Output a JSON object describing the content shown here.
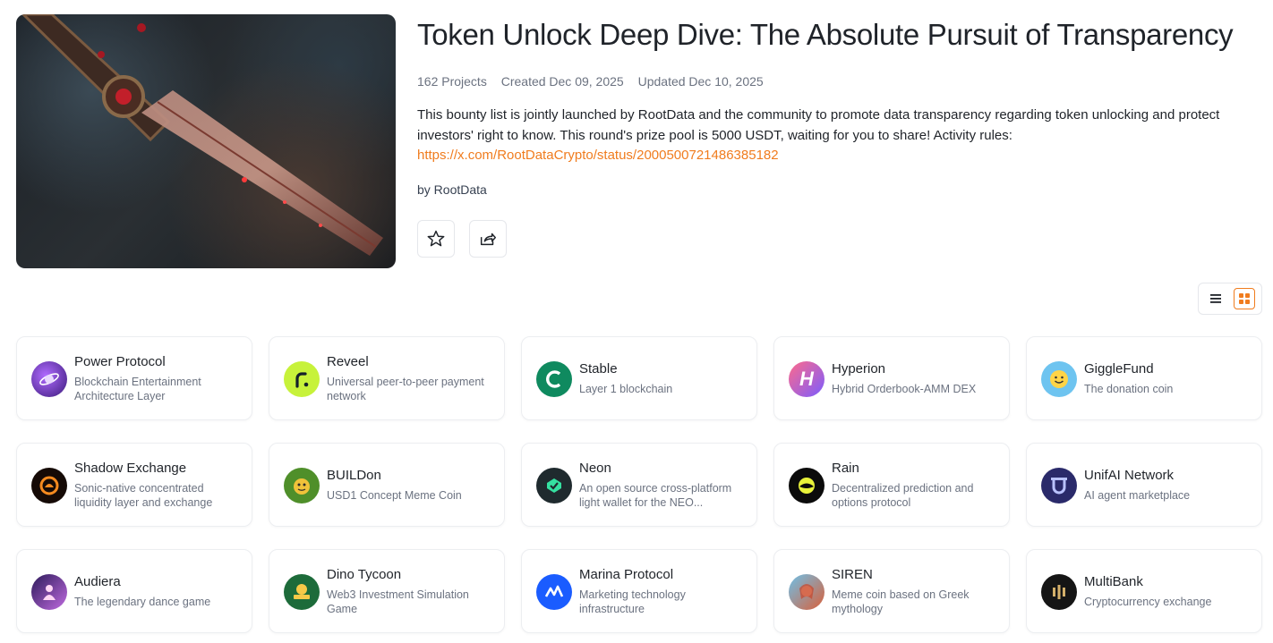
{
  "header": {
    "title": "Token Unlock Deep Dive: The Absolute Pursuit of Transparency",
    "projects_count": "162 Projects",
    "created": "Created Dec 09, 2025",
    "updated": "Updated Dec 10, 2025",
    "description": "This bounty list is jointly launched by RootData and the community to promote data transparency regarding token unlocking and protect investors' right to know. This round's prize pool is 5000 USDT, waiting for you to share! Activity rules:",
    "link": "https://x.com/RootDataCrypto/status/2000500721486385182",
    "byline": "by RootData"
  },
  "actions": {
    "favorite_icon": "star-icon",
    "share_icon": "share-icon"
  },
  "view_toggle": {
    "list_icon": "list-view-icon",
    "grid_icon": "grid-view-icon",
    "active": "grid"
  },
  "accent_color": "#f07c1e",
  "projects": [
    {
      "name": "Power Protocol",
      "desc": "Blockchain Entertainment Architecture Layer"
    },
    {
      "name": "Reveel",
      "desc": "Universal peer-to-peer payment network"
    },
    {
      "name": "Stable",
      "desc": "Layer 1 blockchain"
    },
    {
      "name": "Hyperion",
      "desc": "Hybrid Orderbook-AMM DEX"
    },
    {
      "name": "GiggleFund",
      "desc": "The donation coin"
    },
    {
      "name": "Shadow Exchange",
      "desc": "Sonic-native concentrated liquidity layer and exchange"
    },
    {
      "name": "BUILDon",
      "desc": "USD1 Concept Meme Coin"
    },
    {
      "name": "Neon",
      "desc": "An open source cross-platform light wallet for the NEO..."
    },
    {
      "name": "Rain",
      "desc": "Decentralized prediction and options protocol"
    },
    {
      "name": "UnifAI Network",
      "desc": "AI agent marketplace"
    },
    {
      "name": "Audiera",
      "desc": "The legendary dance game"
    },
    {
      "name": "Dino Tycoon",
      "desc": "Web3 Investment Simulation Game"
    },
    {
      "name": "Marina Protocol",
      "desc": "Marketing technology infrastructure"
    },
    {
      "name": "SIREN",
      "desc": "Meme coin based on Greek mythology"
    },
    {
      "name": "MultiBank",
      "desc": "Cryptocurrency exchange"
    }
  ]
}
